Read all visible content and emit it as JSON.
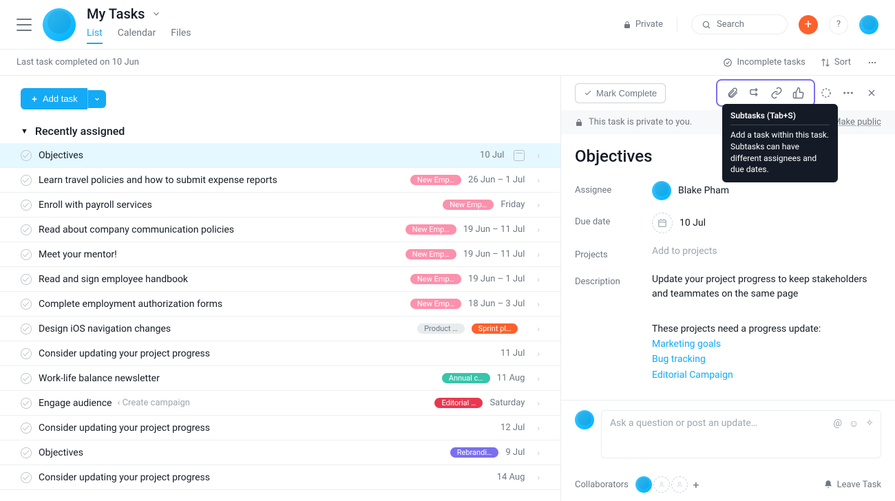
{
  "header": {
    "title": "My Tasks",
    "tabs": [
      "List",
      "Calendar",
      "Files"
    ],
    "active_tab": 0,
    "privacy": "Private",
    "search_placeholder": "Search",
    "help": "?",
    "plus": "+"
  },
  "subline": {
    "text": "Last task completed on 10 Jun",
    "incomplete": "Incomplete tasks",
    "sort": "Sort"
  },
  "left": {
    "add_task": "Add task",
    "section": "Recently assigned",
    "tasks": [
      {
        "name": "Objectives",
        "tags": [],
        "date": "10 Jul",
        "selected": true,
        "cal": true
      },
      {
        "name": "Learn travel policies and how to submit expense reports",
        "tags": [
          {
            "text": "New Emp…",
            "color": "pink"
          }
        ],
        "date": "26 Jun – 1 Jul"
      },
      {
        "name": "Enroll with payroll services",
        "tags": [
          {
            "text": "New Emp…",
            "color": "pink"
          }
        ],
        "date": "Friday"
      },
      {
        "name": "Read about company communication policies",
        "tags": [
          {
            "text": "New Emp…",
            "color": "pink"
          }
        ],
        "date": "19 Jun – 11 Jul"
      },
      {
        "name": "Meet your mentor!",
        "tags": [
          {
            "text": "New Emp…",
            "color": "pink"
          }
        ],
        "date": "19 Jun – 11 Jul"
      },
      {
        "name": "Read and sign employee handbook",
        "tags": [
          {
            "text": "New Emp…",
            "color": "pink"
          }
        ],
        "date": "19 Jun – 1 Jul"
      },
      {
        "name": "Complete employment authorization forms",
        "tags": [
          {
            "text": "New Emp…",
            "color": "pink"
          }
        ],
        "date": "18 Jun – 3 Jul"
      },
      {
        "name": "Design iOS navigation changes",
        "tags": [
          {
            "text": "Product …",
            "color": "grey"
          },
          {
            "text": "Sprint pl…",
            "color": "orange"
          }
        ],
        "date": ""
      },
      {
        "name": "Consider updating your project progress",
        "tags": [],
        "date": "11 Jul"
      },
      {
        "name": "Work-life balance newsletter",
        "tags": [
          {
            "text": "Annual c…",
            "color": "teal"
          }
        ],
        "date": "11 Aug"
      },
      {
        "name": "Engage audience",
        "sub": "‹ Create campaign",
        "tags": [
          {
            "text": "Editorial …",
            "color": "red"
          }
        ],
        "date": "Saturday"
      },
      {
        "name": "Consider updating your project progress",
        "tags": [],
        "date": "12 Jul"
      },
      {
        "name": "Objectives",
        "tags": [
          {
            "text": "Rebrandi…",
            "color": "purple"
          }
        ],
        "date": "9 Jul"
      },
      {
        "name": "Consider updating your project progress",
        "tags": [],
        "date": "14 Aug"
      }
    ]
  },
  "detail": {
    "mark_complete": "Mark Complete",
    "privacy_msg": "This task is private to you.",
    "make_public": "Make public",
    "title": "Objectives",
    "assignee_label": "Assignee",
    "assignee": "Blake Pham",
    "due_label": "Due date",
    "due": "10 Jul",
    "projects_label": "Projects",
    "add_projects": "Add to projects",
    "description_label": "Description",
    "description": "Update your project progress to keep stakeholders and teammates on the same page",
    "needs_update": "These projects need a progress update:",
    "links": [
      "Marketing goals",
      "Bug tracking",
      "Editorial Campaign"
    ]
  },
  "tooltip": {
    "title": "Subtasks (Tab+S)",
    "body": "Add a task within this task. Subtasks can have different assignees and due dates."
  },
  "comment": {
    "placeholder": "Ask a question or post an update…",
    "collaborators": "Collaborators",
    "leave": "Leave Task"
  }
}
